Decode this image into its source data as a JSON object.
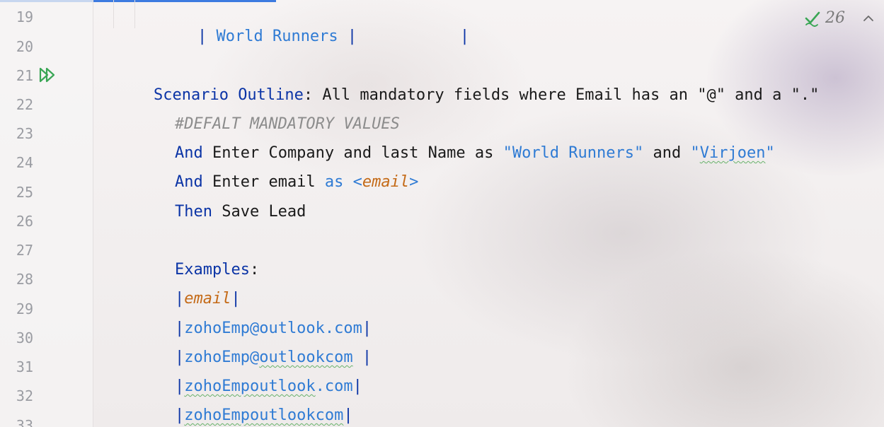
{
  "editor": {
    "inspection": {
      "count": "26",
      "icon": "double-check-icon",
      "icon_color": "#3aa655"
    },
    "colors": {
      "keyword": "#0b34a6",
      "string": "#2f7bd4",
      "comment": "#8c8c8c",
      "parameter": "#c46a17",
      "line_number": "#9a9ca2",
      "progress": "#3d7be0"
    },
    "line_numbers": [
      "19",
      "20",
      "21",
      "22",
      "23",
      "24",
      "25",
      "26",
      "27",
      "28",
      "29",
      "30",
      "31",
      "32",
      "33"
    ],
    "lines": {
      "l19": {
        "pipe_open": "| ",
        "cell": "World Runners",
        "pipe_mid": " |",
        "gap": "          ",
        "pipe_close": " |"
      },
      "l21": {
        "keyword": "Scenario Outline",
        "colon": ":",
        "text": " All mandatory fields where Email has an \"@\" and a \".\""
      },
      "l22": {
        "comment": "#DEFALT MANDATORY VALUES"
      },
      "l23": {
        "keyword": "And",
        "text1": " Enter Company and last Name as ",
        "str1": "\"World Runners\"",
        "text2": " and ",
        "str2_open": "\"",
        "str2_word": "Virjoen",
        "str2_close": "\""
      },
      "l24": {
        "keyword": "And",
        "text1": " Enter email ",
        "as_word": "as",
        "space": " ",
        "lt": "<",
        "param": "email",
        "gt": ">"
      },
      "l25": {
        "keyword": "Then",
        "text": " Save Lead"
      },
      "l27": {
        "keyword": "Examples",
        "colon": ":"
      },
      "l28": {
        "pipe_open": "|",
        "param": "email",
        "pipe_close": "|"
      },
      "l29": {
        "pipe_open": "|",
        "cell_a": "zohoEmp@",
        "cell_b": "outlook",
        "cell_c": ".com",
        "pipe_close": "|"
      },
      "l30": {
        "pipe_open": "|",
        "cell_a": "zohoEmp@",
        "cell_b": "outlookcom",
        "pad": " ",
        "pipe_close": "|"
      },
      "l31": {
        "pipe_open": "|",
        "cell_a": "zohoEmpoutlook",
        "cell_c": ".com",
        "pipe_close": "|"
      },
      "l32": {
        "pipe_open": "|",
        "cell_a": "zohoEmpoutlookcom",
        "pipe_close": "|"
      }
    }
  }
}
